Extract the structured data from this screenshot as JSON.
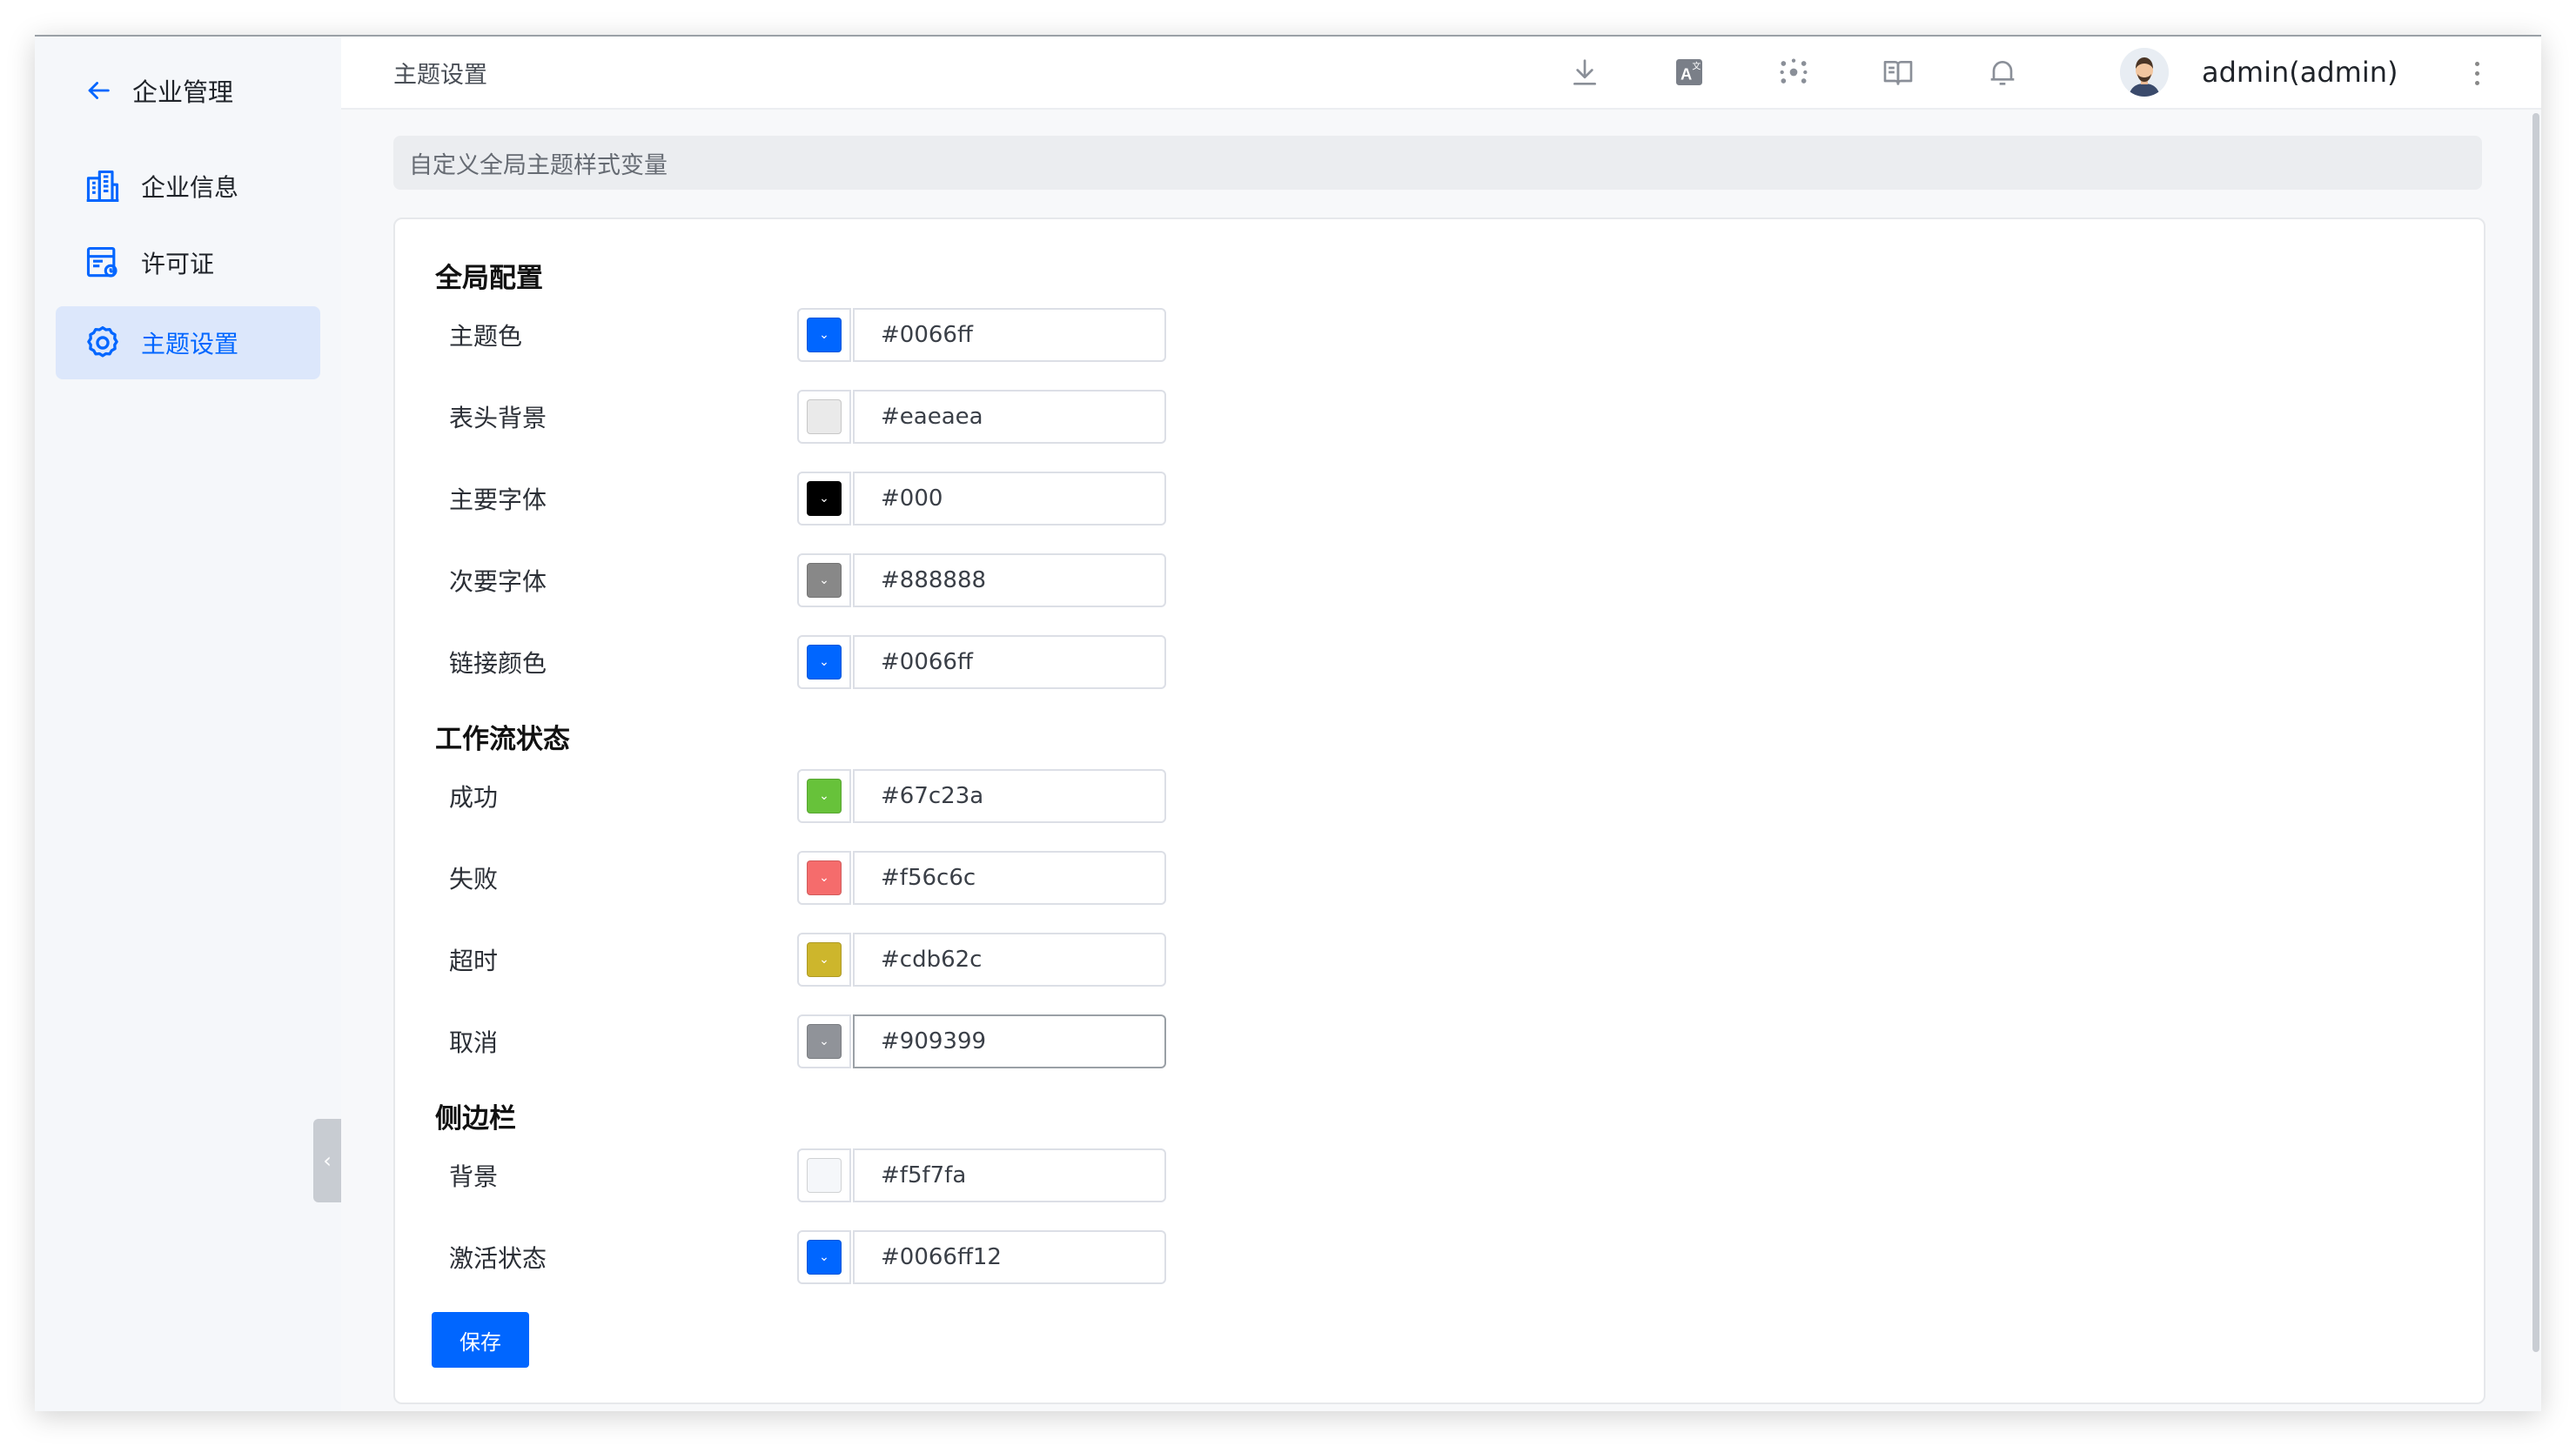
{
  "sidebar": {
    "back_label": "企业管理",
    "items": [
      {
        "label": "企业信息",
        "active": false
      },
      {
        "label": "许可证",
        "active": false
      },
      {
        "label": "主题设置",
        "active": true
      }
    ]
  },
  "header": {
    "title": "主题设置",
    "user_name": "admin(admin)",
    "icons": [
      "download-icon",
      "translate-icon",
      "cluster-icon",
      "book-icon",
      "bell-icon",
      "more-icon"
    ]
  },
  "page": {
    "description": "自定义全局主题样式变量",
    "save_label": "保存"
  },
  "sections": [
    {
      "title": "全局配置",
      "rows": [
        {
          "label": "主题色",
          "value": "#0066ff",
          "color": "#0066ff"
        },
        {
          "label": "表头背景",
          "value": "#eaeaea",
          "color": "#eaeaea"
        },
        {
          "label": "主要字体",
          "value": "#000",
          "color": "#000000"
        },
        {
          "label": "次要字体",
          "value": "#888888",
          "color": "#888888"
        },
        {
          "label": "链接颜色",
          "value": "#0066ff",
          "color": "#0066ff"
        }
      ]
    },
    {
      "title": "工作流状态",
      "rows": [
        {
          "label": "成功",
          "value": "#67c23a",
          "color": "#67c23a"
        },
        {
          "label": "失败",
          "value": "#f56c6c",
          "color": "#f56c6c"
        },
        {
          "label": "超时",
          "value": "#cdb62c",
          "color": "#cdb62c"
        },
        {
          "label": "取消",
          "value": "#909399",
          "color": "#909399"
        }
      ]
    },
    {
      "title": "侧边栏",
      "rows": [
        {
          "label": "背景",
          "value": "#f5f7fa",
          "color": "#f5f7fa"
        },
        {
          "label": "激活状态",
          "value": "#0066ff12",
          "color": "#0066ff"
        }
      ]
    }
  ]
}
